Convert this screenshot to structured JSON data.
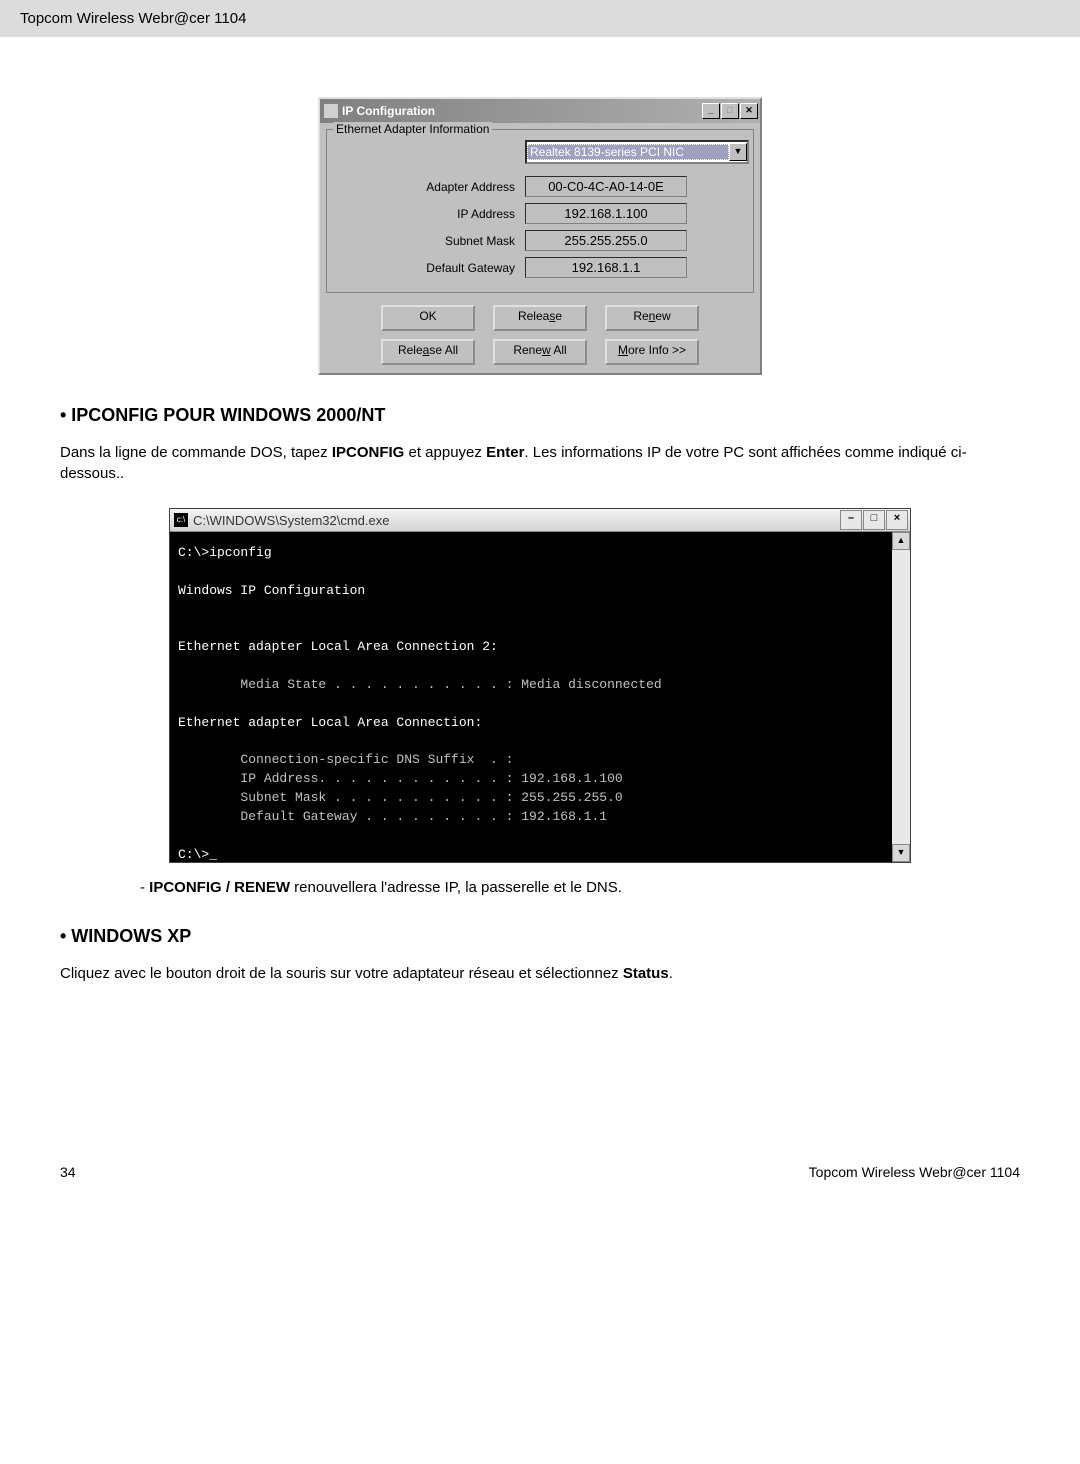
{
  "header": {
    "text": "Topcom Wireless Webr@cer 1104"
  },
  "ipconfig_dialog": {
    "title": "IP Configuration",
    "fieldset_title": "Ethernet Adapter Information",
    "adapter_selected": "Realtek 8139-series PCI NIC",
    "rows": {
      "adapter_address": {
        "label": "Adapter Address",
        "value": "00-C0-4C-A0-14-0E"
      },
      "ip_address": {
        "label": "IP Address",
        "value": "192.168.1.100"
      },
      "subnet_mask": {
        "label": "Subnet Mask",
        "value": "255.255.255.0"
      },
      "default_gateway": {
        "label": "Default Gateway",
        "value": "192.168.1.1"
      }
    },
    "buttons": {
      "ok": "OK",
      "release": "Release",
      "renew": "Renew",
      "release_all": "Release All",
      "renew_all": "Renew All",
      "more_info": "More Info >>"
    }
  },
  "section1": {
    "heading": "• IPCONFIG POUR WINDOWS 2000/NT",
    "para_prefix": "Dans la ligne de commande DOS, tapez ",
    "ipconfig_bold": "IPCONFIG",
    "para_mid": " et appuyez ",
    "enter_bold": "Enter",
    "para_suffix": ".  Les informations IP de votre PC sont affichées comme indiqué ci-dessous.."
  },
  "cmd": {
    "title": "C:\\WINDOWS\\System32\\cmd.exe",
    "lines": {
      "l1": "C:\\>ipconfig",
      "l2": "Windows IP Configuration",
      "l3": "Ethernet adapter Local Area Connection 2:",
      "l4": "        Media State . . . . . . . . . . . : Media disconnected",
      "l5": "Ethernet adapter Local Area Connection:",
      "l6": "        Connection-specific DNS Suffix  . :",
      "l7": "        IP Address. . . . . . . . . . . . : 192.168.1.100",
      "l8": "        Subnet Mask . . . . . . . . . . . : 255.255.255.0",
      "l9": "        Default Gateway . . . . . . . . . : 192.168.1.1",
      "l10": "C:\\>_"
    }
  },
  "sub_bullet": {
    "prefix": "- ",
    "bold": "IPCONFIG / RENEW",
    "rest": " renouvellera l'adresse IP, la passerelle et le DNS."
  },
  "section2": {
    "heading": "• WINDOWS XP",
    "para_prefix": "Cliquez avec le bouton droit de la souris sur votre adaptateur réseau et sélectionnez ",
    "bold": "Status",
    "suffix": "."
  },
  "footer": {
    "page": "34",
    "right": "Topcom Wireless Webr@cer 1104"
  }
}
